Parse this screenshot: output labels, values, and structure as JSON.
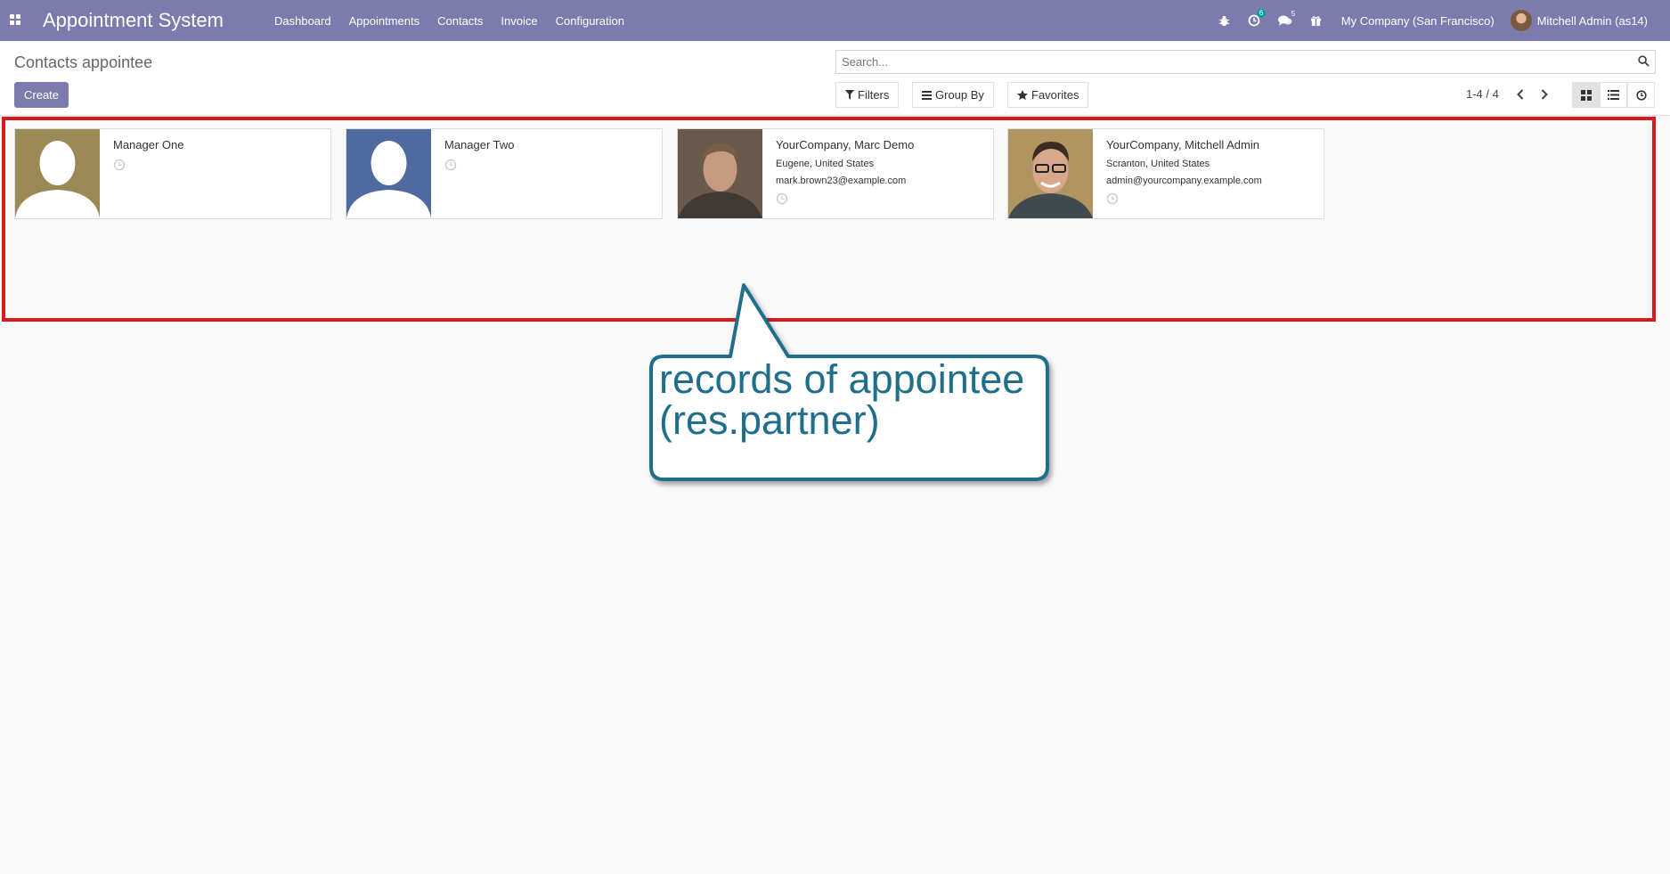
{
  "navbar": {
    "brand": "Appointment System",
    "menu": [
      "Dashboard",
      "Appointments",
      "Contacts",
      "Invoice",
      "Configuration"
    ],
    "activity_badge": "6",
    "messages_badge": "5",
    "company": "My Company (San Francisco)",
    "user": "Mitchell Admin (as14)"
  },
  "control_panel": {
    "breadcrumb": "Contacts appointee",
    "create_label": "Create",
    "search_placeholder": "Search...",
    "filters_label": "Filters",
    "groupby_label": "Group By",
    "favorites_label": "Favorites",
    "pager": "1-4 / 4"
  },
  "cards": [
    {
      "name": "Manager One",
      "city": "",
      "email": "",
      "image": "placeholder-olive"
    },
    {
      "name": "Manager Two",
      "city": "",
      "email": "",
      "image": "placeholder-blue"
    },
    {
      "name": "YourCompany, Marc Demo",
      "city": "Eugene, United States",
      "email": "mark.brown23@example.com",
      "image": "photo"
    },
    {
      "name": "YourCompany, Mitchell Admin",
      "city": "Scranton, United States",
      "email": "admin@yourcompany.example.com",
      "image": "photo"
    }
  ],
  "annotation": {
    "line1": "records of appointee",
    "line2": "(res.partner)",
    "colors": {
      "highlight": "#d61a1f",
      "callout": "#1f6e8c"
    }
  }
}
